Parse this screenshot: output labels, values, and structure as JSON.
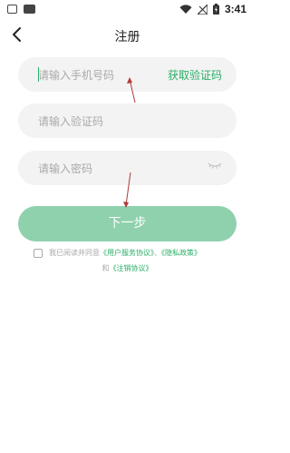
{
  "status_bar": {
    "time": "3:41"
  },
  "nav": {
    "title": "注册"
  },
  "form": {
    "phone_placeholder": "请输入手机号码",
    "get_code_label": "获取验证码",
    "code_placeholder": "请输入验证码",
    "password_placeholder": "请输入密码"
  },
  "next_button": {
    "label": "下一步"
  },
  "agreement": {
    "prefix": "我已阅读并同意",
    "user_service": "《用户服务协议》",
    "separator": "、",
    "privacy": "《隐私政策》",
    "and": "和",
    "cancellation": "《注销协议》"
  },
  "colors": {
    "accent": "#2aae67",
    "button": "#8fd1ad",
    "annotation_arrow": "#b03a3a"
  },
  "icons": [
    "notification-icon",
    "app-icon",
    "wifi-icon",
    "signal-icon",
    "battery-icon",
    "back-icon",
    "eye-closed-icon"
  ]
}
